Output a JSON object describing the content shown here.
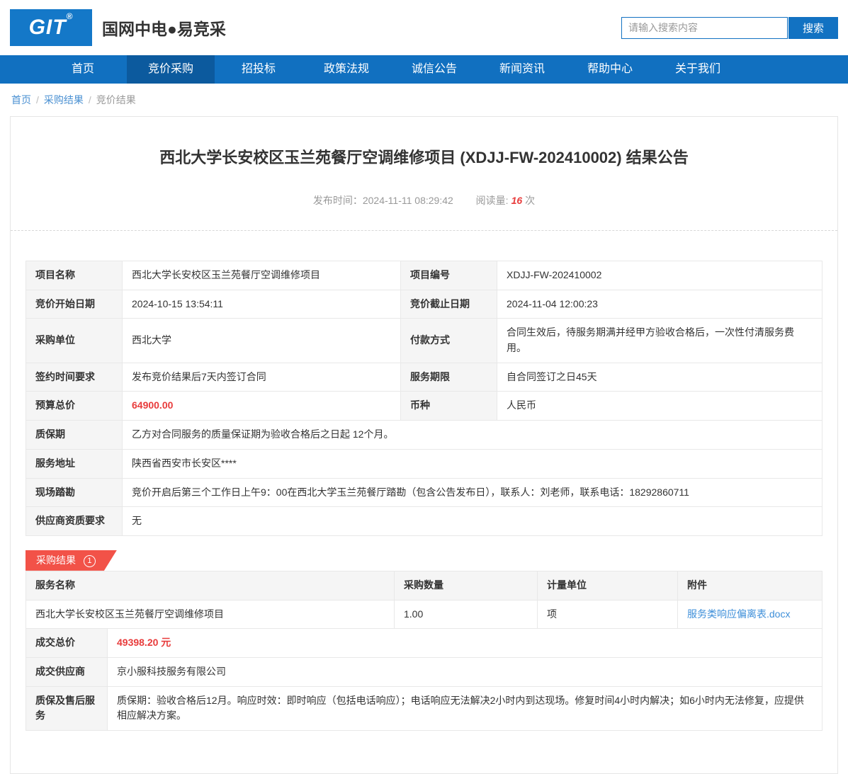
{
  "brand": {
    "logo_text": "GIT",
    "logo_reg": "®",
    "site_name": "国网中电●易竞采"
  },
  "search": {
    "placeholder": "请输入搜索内容",
    "button_label": "搜索"
  },
  "nav": {
    "items": [
      {
        "label": "首页",
        "active": false
      },
      {
        "label": "竞价采购",
        "active": true
      },
      {
        "label": "招投标",
        "active": false
      },
      {
        "label": "政策法规",
        "active": false
      },
      {
        "label": "诚信公告",
        "active": false
      },
      {
        "label": "新闻资讯",
        "active": false
      },
      {
        "label": "帮助中心",
        "active": false
      },
      {
        "label": "关于我们",
        "active": false
      }
    ]
  },
  "breadcrumb": {
    "items": [
      "首页",
      "采购结果",
      "竞价结果"
    ]
  },
  "article": {
    "title": "西北大学长安校区玉兰苑餐厅空调维修项目 (XDJJ-FW-202410002) 结果公告",
    "publish_label": "发布时间：",
    "publish_time": "2024-11-11 08:29:42",
    "views_label": "阅读量:",
    "views_count": "16",
    "views_unit": "次"
  },
  "info_table": {
    "rows4": [
      {
        "l1": "项目名称",
        "v1": "西北大学长安校区玉兰苑餐厅空调维修项目",
        "l2": "项目编号",
        "v2": "XDJJ-FW-202410002"
      },
      {
        "l1": "竞价开始日期",
        "v1": "2024-10-15 13:54:11",
        "l2": "竞价截止日期",
        "v2": "2024-11-04 12:00:23"
      },
      {
        "l1": "采购单位",
        "v1": "西北大学",
        "l2": "付款方式",
        "v2": "合同生效后，待服务期满并经甲方验收合格后，一次性付清服务费用。"
      },
      {
        "l1": "签约时间要求",
        "v1": "发布竞价结果后7天内签订合同",
        "l2": "服务期限",
        "v2": "自合同签订之日45天"
      },
      {
        "l1": "预算总价",
        "v1": "64900.00",
        "l2": "币种",
        "v2": "人民币"
      }
    ],
    "rows_full": [
      {
        "label": "质保期",
        "value": "乙方对合同服务的质量保证期为验收合格后之日起 12个月。"
      },
      {
        "label": "服务地址",
        "value": "陕西省西安市长安区****"
      },
      {
        "label": "现场踏勘",
        "value": "竞价开启后第三个工作日上午9：00在西北大学玉兰苑餐厅踏勘（包含公告发布日），联系人：刘老师，联系电话：18292860711"
      },
      {
        "label": "供应商资质要求",
        "value": "无"
      }
    ]
  },
  "result_section": {
    "badge_label": "采购结果",
    "badge_count": "1"
  },
  "result_table": {
    "headers": [
      "服务名称",
      "采购数量",
      "计量单位",
      "附件"
    ],
    "row": {
      "name": "西北大学长安校区玉兰苑餐厅空调维修项目",
      "qty": "1.00",
      "unit": "项",
      "attachment": "服务类响应偏离表.docx"
    },
    "summary": [
      {
        "label": "成交总价",
        "value": "49398.20 元"
      },
      {
        "label": "成交供应商",
        "value": "京小服科技服务有限公司"
      },
      {
        "label": "质保及售后服务",
        "value": "质保期：验收合格后12月。响应时效：即时响应（包括电话响应）；电话响应无法解决2小时内到达现场。修复时间4小时内解决；如6小时内无法修复，应提供相应解决方案。"
      }
    ]
  },
  "colors": {
    "nav_blue": "#1170c0",
    "nav_active_blue": "#0c5a9e",
    "logo_blue": "#1478c8",
    "link_blue": "#4a90d2",
    "attachment_blue": "#3e8fd9",
    "price_red": "#e83c3c",
    "badge_red": "#f25248"
  }
}
